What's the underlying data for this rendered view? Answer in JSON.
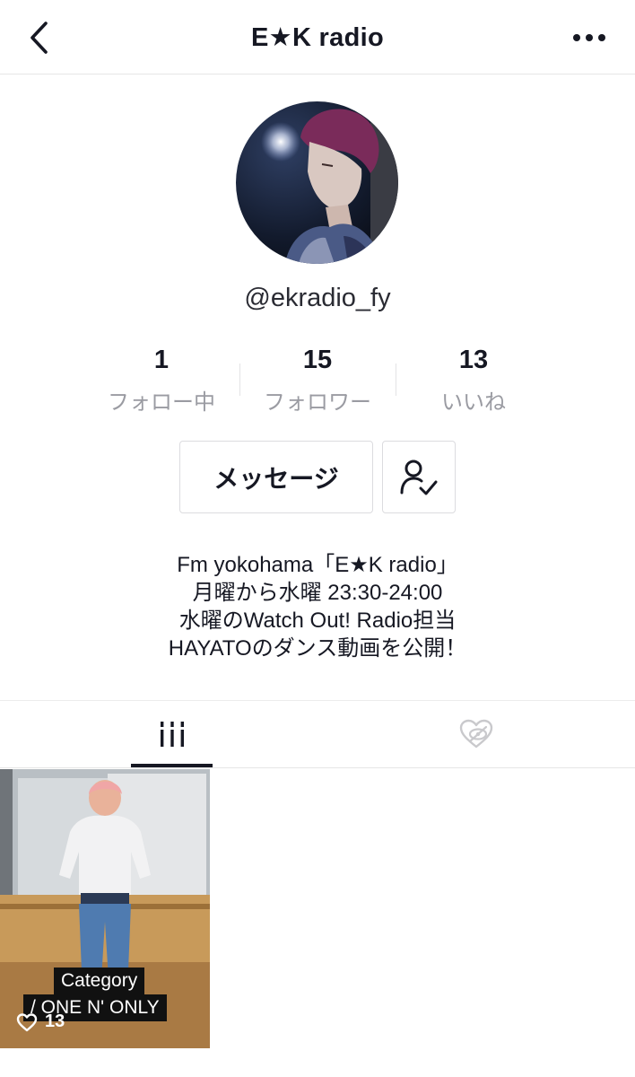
{
  "header": {
    "title": "E★K radio",
    "back_icon": "chevron-left-icon",
    "more_icon": "more-horizontal-icon"
  },
  "profile": {
    "handle": "@ekradio_fy",
    "avatar_icon": "avatar"
  },
  "stats": [
    {
      "value": "1",
      "label": "フォロー中"
    },
    {
      "value": "15",
      "label": "フォロワー"
    },
    {
      "value": "13",
      "label": "いいね"
    }
  ],
  "actions": {
    "message_label": "メッセージ",
    "follow_icon": "user-check-icon"
  },
  "bio": {
    "lines": [
      "Fm yokohama「E★K radio」",
      "月曜から水曜 23:30-24:00",
      "水曜のWatch Out! Radio担当",
      "HAYATOのダンス動画を公開！"
    ]
  },
  "tabs": [
    {
      "icon": "videos-grid-icon",
      "active": true
    },
    {
      "icon": "liked-hidden-icon",
      "active": false
    }
  ],
  "videos": [
    {
      "caption_line1": "Category",
      "caption_line2": "/ ONE N' ONLY",
      "likes": "13"
    }
  ],
  "colors": {
    "text": "#161823",
    "secondary": "#9a9ba2",
    "border": "#dcdcdf"
  }
}
